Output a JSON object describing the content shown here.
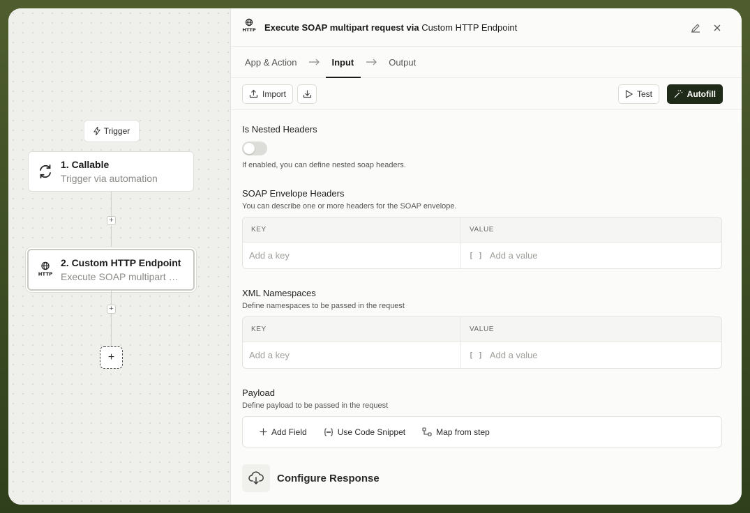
{
  "canvas": {
    "trigger_label": "Trigger",
    "nodes": [
      {
        "title": "1. Callable",
        "subtitle": "Trigger via automation"
      },
      {
        "title": "2. Custom HTTP Endpoint",
        "subtitle": "Execute SOAP multipart request via Custom HTTP Endpoint"
      }
    ],
    "add_symbol": "+"
  },
  "panel": {
    "title_bold": "Execute SOAP multipart request via",
    "title_light": "Custom HTTP Endpoint",
    "tabs": [
      "App & Action",
      "Input",
      "Output"
    ],
    "active_tab": "Input",
    "toolbar": {
      "import_label": "Import",
      "test_label": "Test",
      "autofill_label": "Autofill"
    },
    "nested_headers": {
      "title": "Is Nested Headers",
      "description": "If enabled, you can define nested soap headers.",
      "enabled": false
    },
    "soap_headers": {
      "title": "SOAP Envelope Headers",
      "description": "You can describe one or more headers for the SOAP envelope.",
      "key_header": "KEY",
      "value_header": "VALUE",
      "key_placeholder": "Add a key",
      "value_placeholder": "Add a value"
    },
    "xml_namespaces": {
      "title": "XML Namespaces",
      "description": "Define namespaces to be passed in the request",
      "key_header": "KEY",
      "value_header": "VALUE",
      "key_placeholder": "Add a key",
      "value_placeholder": "Add a value"
    },
    "payload": {
      "title": "Payload",
      "description": "Define payload to be passed in the request",
      "actions": [
        "Add Field",
        "Use Code Snippet",
        "Map from step"
      ]
    },
    "configure_response_label": "Configure Response"
  }
}
